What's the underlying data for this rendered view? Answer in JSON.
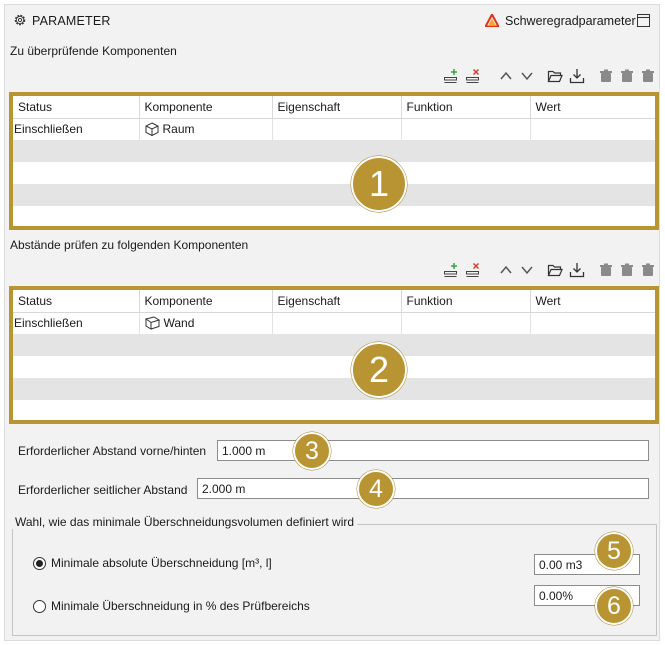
{
  "header": {
    "title": "PARAMETER",
    "icon": "gear-icon",
    "severity_label": "Schweregradparameter",
    "severity_icon": "warning-triangle-icon",
    "window_icon": "window-icon"
  },
  "section1": {
    "label": "Zu überprüfende Komponenten",
    "columns": [
      "Status",
      "Komponente",
      "Eigenschaft",
      "Funktion",
      "Wert"
    ],
    "rows": [
      {
        "status": "Einschließen",
        "component": "Raum",
        "component_icon": "cube-icon",
        "property": "",
        "function": "",
        "value": ""
      }
    ],
    "badge": "1"
  },
  "section2": {
    "label": "Abstände prüfen zu folgenden Komponenten",
    "columns": [
      "Status",
      "Komponente",
      "Eigenschaft",
      "Funktion",
      "Wert"
    ],
    "rows": [
      {
        "status": "Einschließen",
        "component": "Wand",
        "component_icon": "wall-icon",
        "property": "",
        "function": "",
        "value": ""
      }
    ],
    "badge": "2"
  },
  "toolbar": {
    "icons": [
      "add-row-icon",
      "remove-row-icon",
      "move-up-icon",
      "move-down-icon",
      "open-folder-icon",
      "import-icon",
      "delete-icon",
      "delete-icon",
      "delete-icon"
    ]
  },
  "clearance": {
    "front_back_label": "Erforderlicher Abstand vorne/hinten",
    "front_back_value": "1.000 m",
    "side_label": "Erforderlicher seitlicher Abstand",
    "side_value": "2.000 m",
    "badge_front_back": "3",
    "badge_side": "4"
  },
  "overlap": {
    "group_label": "Wahl, wie das minimale Überschneidungsvolumen definiert wird",
    "absolute_label": "Minimale absolute Überschneidung [m³, l]",
    "absolute_value": "0.00 m3",
    "absolute_selected": true,
    "percent_label": "Minimale Überschneidung in % des Prüfbereichs",
    "percent_value": "0.00%",
    "percent_selected": false,
    "badge_absolute": "5",
    "badge_percent": "6"
  },
  "colors": {
    "accent": "#b99432",
    "panel_bg": "#f2f2f2",
    "alt_row": "#e4e4e4",
    "warning_red": "#e0301e",
    "warning_orange": "#f5a623"
  }
}
